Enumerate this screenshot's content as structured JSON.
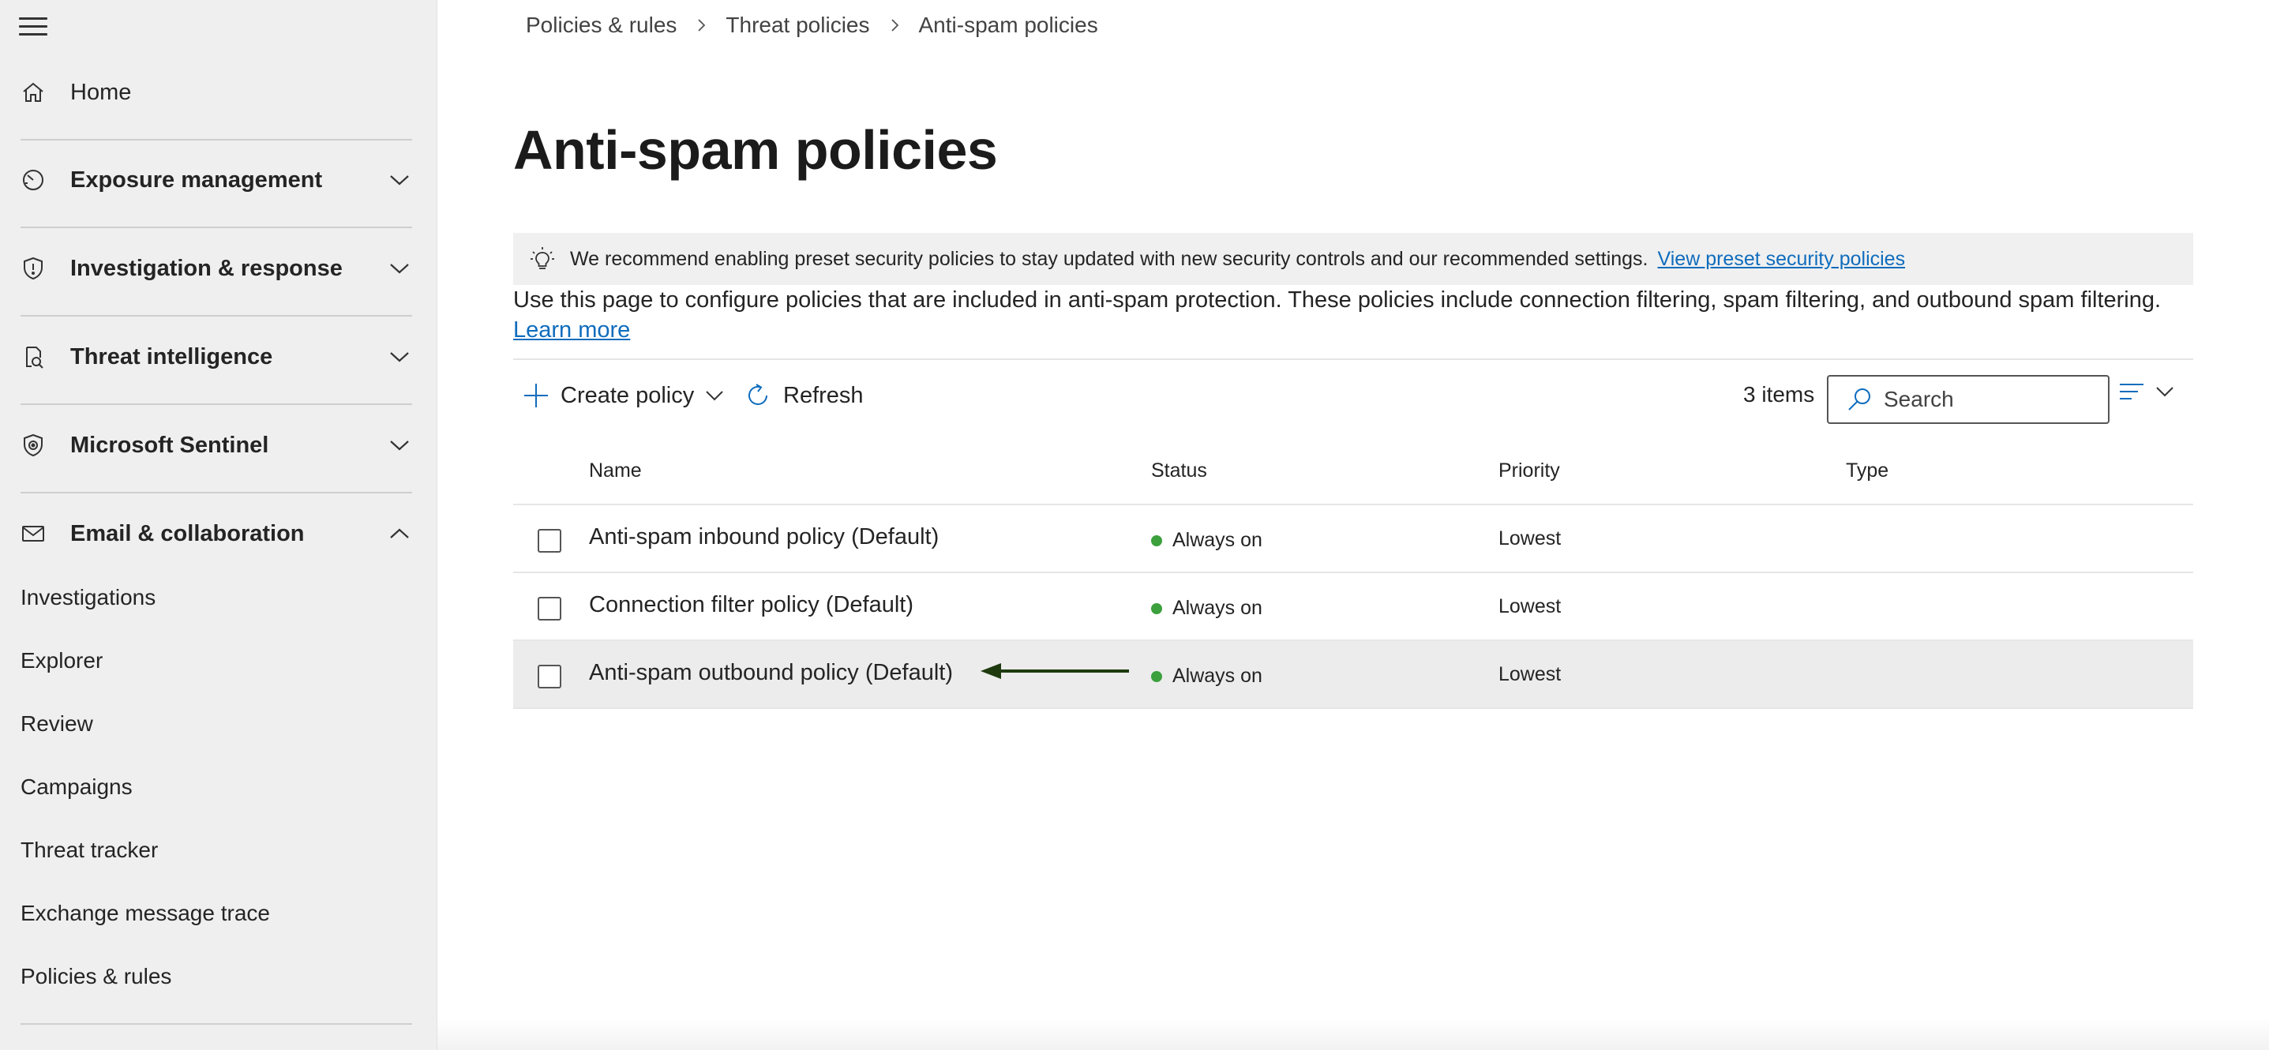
{
  "breadcrumb": [
    "Policies & rules",
    "Threat policies",
    "Anti-spam policies"
  ],
  "page_title": "Anti-spam policies",
  "sidebar": {
    "items": [
      {
        "label": "Home",
        "icon": "home-icon"
      },
      {
        "label": "Exposure management",
        "icon": "gauge-icon"
      },
      {
        "label": "Investigation & response",
        "icon": "shield-icon"
      },
      {
        "label": "Threat intelligence",
        "icon": "threat-intel-icon"
      },
      {
        "label": "Microsoft Sentinel",
        "icon": "sentinel-icon"
      },
      {
        "label": "Email & collaboration",
        "icon": "mail-icon"
      }
    ],
    "sub_items": [
      "Investigations",
      "Explorer",
      "Review",
      "Campaigns",
      "Threat tracker",
      "Exchange message trace",
      "Policies & rules"
    ]
  },
  "banner": {
    "text": "We recommend enabling preset security policies to stay updated with new security controls and our recommended settings.",
    "link": "View preset security policies",
    "icon": "lightbulb-icon"
  },
  "description": {
    "text": "Use this page to configure policies that are included in anti-spam protection. These policies include connection filtering, spam filtering, and outbound spam filtering.",
    "link": "Learn more"
  },
  "toolbar": {
    "create_label": "Create policy",
    "refresh_label": "Refresh",
    "items_count": "3 items",
    "search_placeholder": "Search"
  },
  "table": {
    "columns": [
      "Name",
      "Status",
      "Priority",
      "Type"
    ],
    "rows": [
      {
        "name": "Anti-spam inbound policy (Default)",
        "status": "Always on",
        "priority": "Lowest",
        "type": ""
      },
      {
        "name": "Connection filter policy (Default)",
        "status": "Always on",
        "priority": "Lowest",
        "type": ""
      },
      {
        "name": "Anti-spam outbound policy (Default)",
        "status": "Always on",
        "priority": "Lowest",
        "type": ""
      }
    ]
  },
  "colors": {
    "accent_link": "#0f6cbd",
    "status_on": "#3ca03c",
    "annotation_arrow": "#1e3a0e",
    "sidebar_bg": "#efefef"
  }
}
